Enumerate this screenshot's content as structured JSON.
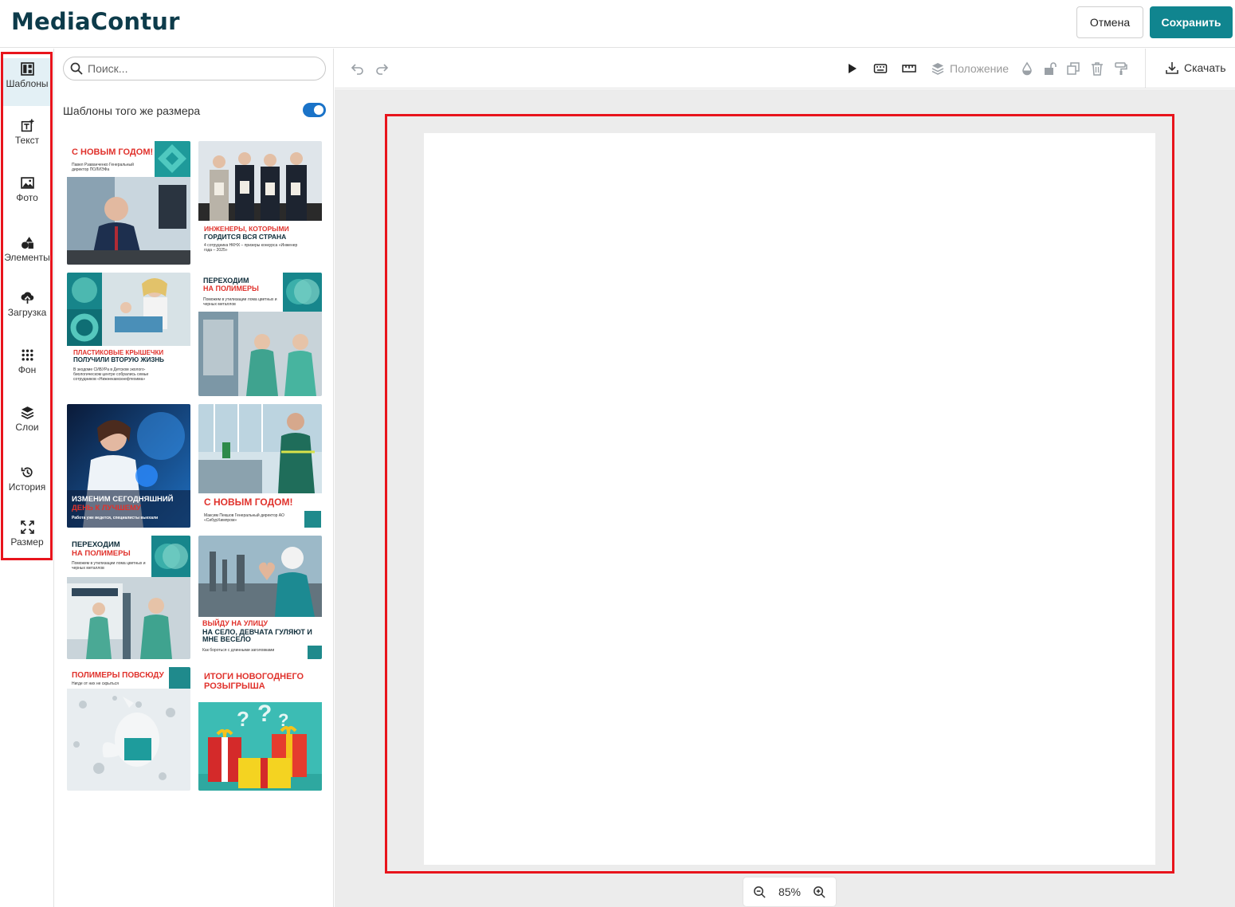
{
  "header": {
    "logo": "MediaContur",
    "cancel_label": "Отмена",
    "save_label": "Сохранить"
  },
  "sidebar": {
    "items": [
      {
        "label": "Шаблоны",
        "icon": "templates-icon"
      },
      {
        "label": "Текст",
        "icon": "text-icon"
      },
      {
        "label": "Фото",
        "icon": "photo-icon"
      },
      {
        "label": "Элементы",
        "icon": "elements-icon"
      },
      {
        "label": "Загрузка",
        "icon": "upload-icon"
      },
      {
        "label": "Фон",
        "icon": "background-icon"
      },
      {
        "label": "Слои",
        "icon": "layers-icon"
      },
      {
        "label": "История",
        "icon": "history-icon"
      },
      {
        "label": "Размер",
        "icon": "resize-icon"
      }
    ],
    "active_index": 0
  },
  "panel": {
    "search_placeholder": "Поиск...",
    "same_size_label": "Шаблоны того же размера",
    "same_size_enabled": true,
    "templates": [
      {
        "title": "С НОВЫМ ГОДОМ!",
        "sub": "Павел Рзаванченко Генеральный директор ПОЛИЭФа"
      },
      {
        "title_red": "ИНЖЕНЕРЫ, КОТОРЫМИ",
        "title_dark": "ГОРДИТСЯ ВСЯ СТРАНА",
        "sub": "4 сотрудника НКНХ – призеры конкурса «Инженер года – 2025»"
      },
      {
        "title_red": "ПЛАСТИКОВЫЕ КРЫШЕЧКИ",
        "title_dark": "ПОЛУЧИЛИ ВТОРУЮ ЖИЗНЬ",
        "sub": "В экодоме СИБУРа в Детском эколого-биологическом центре собрались семьи сотрудников «Нижнекамскнефтехима»"
      },
      {
        "title_dark": "ПЕРЕХОДИМ",
        "title_red": "НА ПОЛИМЕРЫ",
        "sub": "Поможем в утилизации лома цветных и черных металлов"
      },
      {
        "title_white": "ИЗМЕНИМ СЕГОДНЯШНИЙ",
        "title_red": "ДЕНЬ К ЛУЧШЕМУ",
        "sub": "Работа уже ведется, специалисты выехали"
      },
      {
        "title": "С НОВЫМ ГОДОМ!",
        "sub": "Максим Пекшов Генеральный директор АО «СибурХимпром»"
      },
      {
        "title_dark": "ПЕРЕХОДИМ",
        "title_red": "НА ПОЛИМЕРЫ",
        "sub": "Поможем в утилизации лома цветных и черных металлов"
      },
      {
        "title_red": "ВЫЙДУ НА УЛИЦУ",
        "title_dark": "НА СЕЛО, ДЕВЧАТА ГУЛЯЮТ И МНЕ ВЕСЕЛО",
        "sub": "Как бороться с длинными заголовками"
      },
      {
        "title": "ПОЛИМЕРЫ ПОВСЮДУ",
        "sub": "Нигде от них не скрыться"
      },
      {
        "title": "ИТОГИ НОВОГОДНЕГО РОЗЫГРЫША",
        "sub": ""
      }
    ]
  },
  "toolbar": {
    "position_label": "Положение",
    "download_label": "Скачать"
  },
  "zoom": {
    "value": "85%"
  },
  "colors": {
    "accent": "#10858f",
    "highlight": "#e8141c",
    "toggle": "#1a73c8",
    "brand_dark": "#0d3b4a"
  }
}
